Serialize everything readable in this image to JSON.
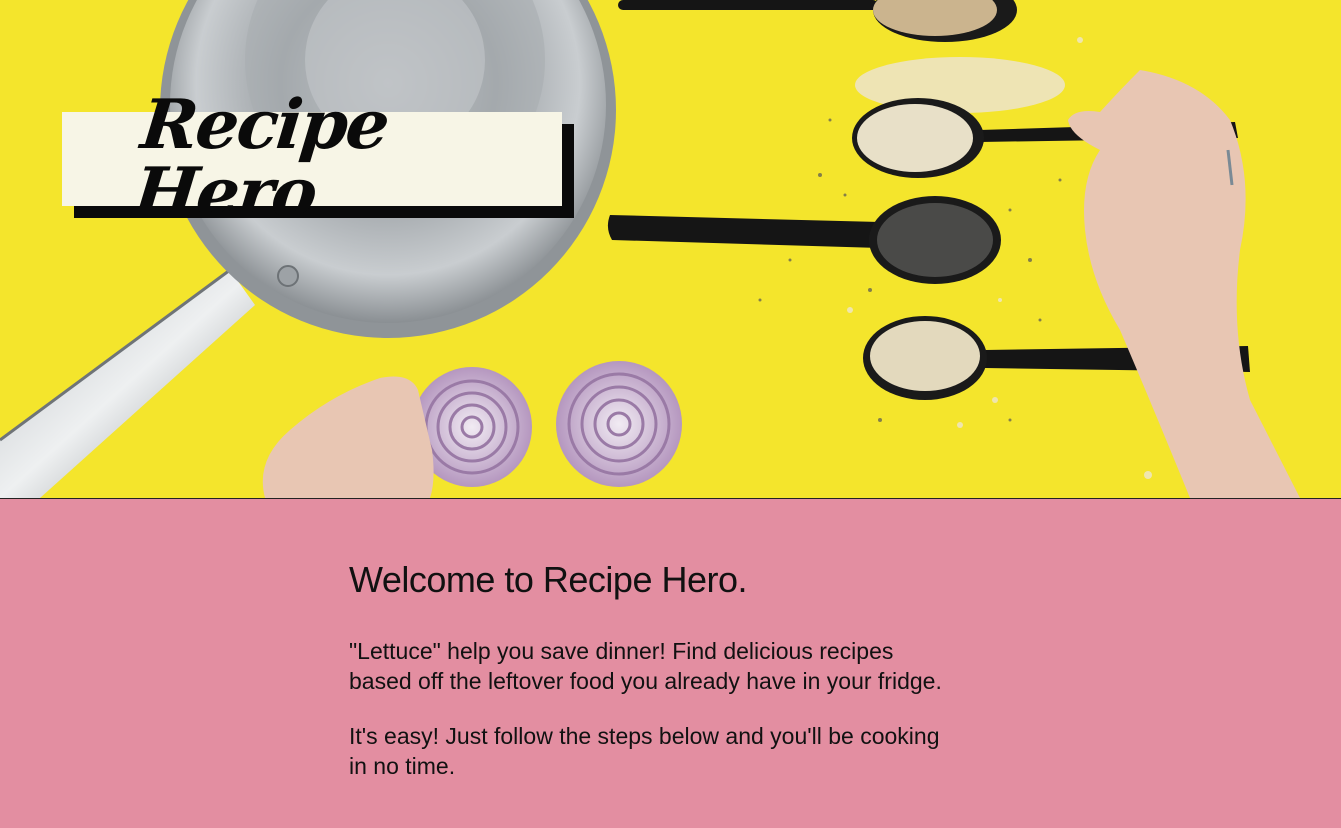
{
  "hero": {
    "logo_text": "Recipe Hero",
    "background_color": "#f4e52c"
  },
  "content": {
    "background_color": "#e38ea1",
    "heading": "Welcome to Recipe Hero.",
    "paragraph_1_line_1": "\"Lettuce\" help you save dinner! Find delicious recipes",
    "paragraph_1_line_2": "based off the leftover food you already have in your fridge.",
    "paragraph_2_line_1": "It's easy! Just follow the steps below and you'll be cooking",
    "paragraph_2_line_2": "in no time."
  }
}
